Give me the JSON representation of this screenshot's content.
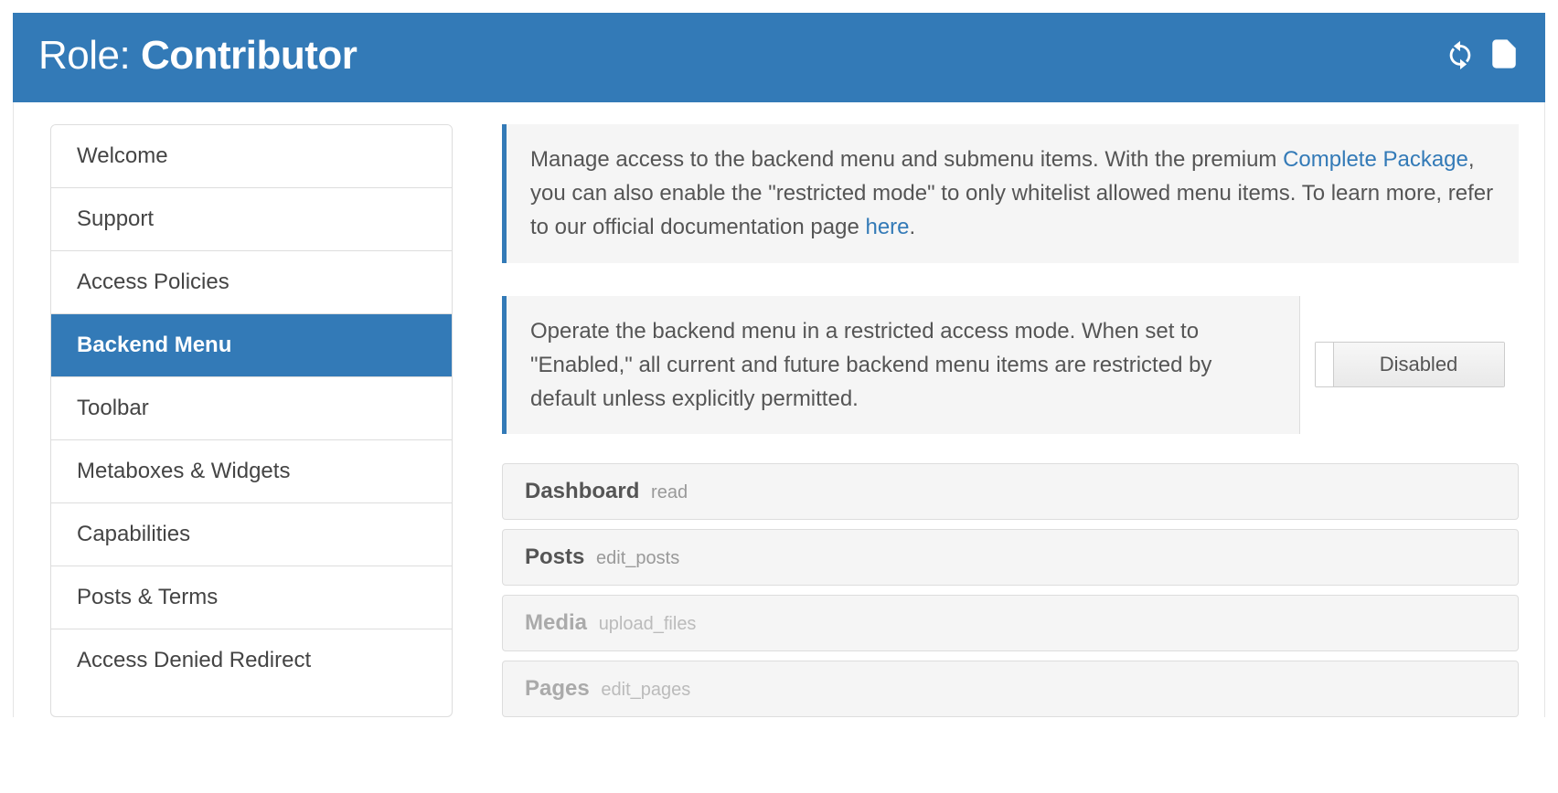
{
  "header": {
    "title_prefix": "Role: ",
    "role_name": "Contributor"
  },
  "sidebar": {
    "items": [
      {
        "label": "Welcome",
        "active": false
      },
      {
        "label": "Support",
        "active": false
      },
      {
        "label": "Access Policies",
        "active": false
      },
      {
        "label": "Backend Menu",
        "active": true
      },
      {
        "label": "Toolbar",
        "active": false
      },
      {
        "label": "Metaboxes & Widgets",
        "active": false
      },
      {
        "label": "Capabilities",
        "active": false
      },
      {
        "label": "Posts & Terms",
        "active": false
      },
      {
        "label": "Access Denied Redirect",
        "active": false
      }
    ]
  },
  "info": {
    "text_before_link1": "Manage access to the backend menu and submenu items. With the premium ",
    "link1": "Complete Package",
    "text_mid": ", you can also enable the \"restricted mode\" to only whitelist allowed menu items. To learn more, refer to our official documentation page ",
    "link2": "here",
    "text_after": "."
  },
  "restrict": {
    "text": "Operate the backend menu in a restricted access mode. When set to \"Enabled,\" all current and future backend menu items are restricted by default unless explicitly permitted.",
    "toggle_label": "Disabled"
  },
  "menu_items": [
    {
      "title": "Dashboard",
      "cap": "read",
      "dim": false
    },
    {
      "title": "Posts",
      "cap": "edit_posts",
      "dim": false
    },
    {
      "title": "Media",
      "cap": "upload_files",
      "dim": true
    },
    {
      "title": "Pages",
      "cap": "edit_pages",
      "dim": true
    }
  ]
}
